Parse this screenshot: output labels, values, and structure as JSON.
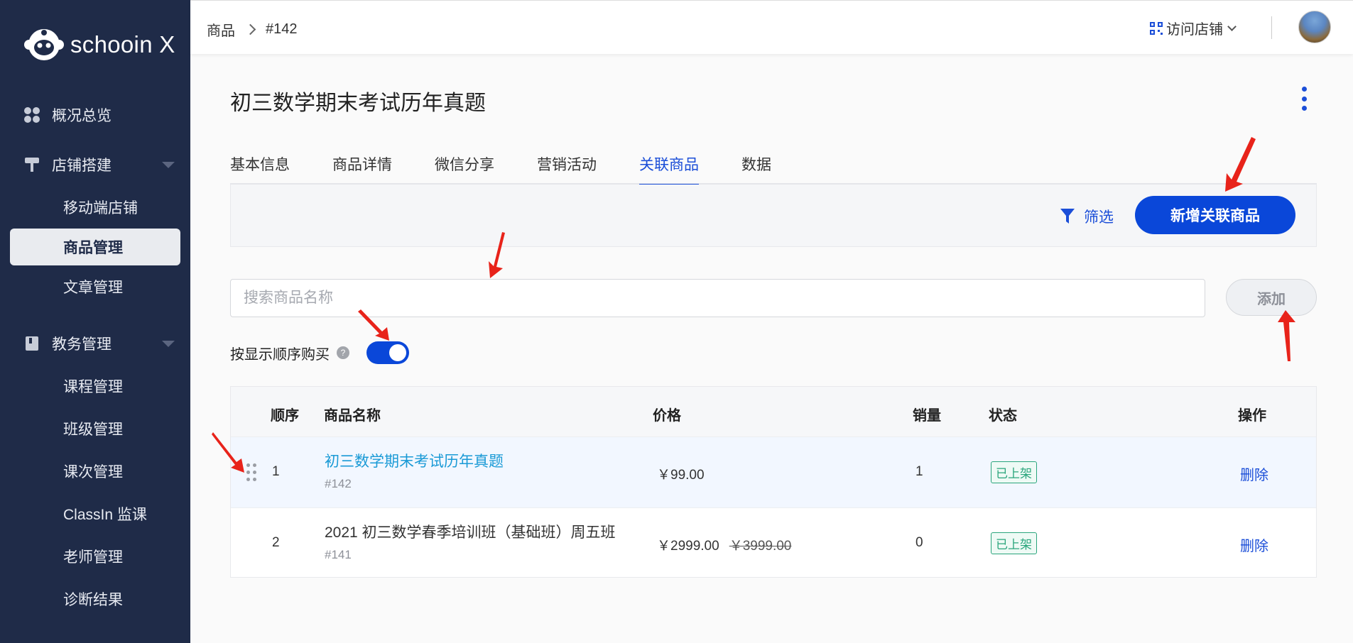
{
  "app": {
    "logo_text": "schooin X"
  },
  "sidebar": {
    "groups": [
      {
        "label": "概况总览"
      },
      {
        "label": "店铺搭建",
        "children": [
          "移动端店铺",
          "商品管理",
          "文章管理"
        ]
      },
      {
        "label": "教务管理",
        "children": [
          "课程管理",
          "班级管理",
          "课次管理",
          "ClassIn 监课",
          "老师管理",
          "诊断结果"
        ]
      }
    ],
    "active_item": "商品管理"
  },
  "topbar": {
    "breadcrumb": [
      "商品",
      "#142"
    ],
    "visit_store": "访问店铺"
  },
  "page": {
    "title": "初三数学期末考试历年真题",
    "tabs": [
      "基本信息",
      "商品详情",
      "微信分享",
      "营销活动",
      "关联商品",
      "数据"
    ],
    "active_tab": "关联商品"
  },
  "toolbar": {
    "filter_label": "筛选",
    "add_related_label": "新增关联商品"
  },
  "search": {
    "placeholder": "搜索商品名称",
    "value": ""
  },
  "add_button": "添加",
  "order_option": {
    "label": "按显示顺序购买",
    "help": "?",
    "enabled": true
  },
  "table": {
    "headers": [
      "顺序",
      "商品名称",
      "价格",
      "销量",
      "状态",
      "操作"
    ],
    "rows": [
      {
        "order": "1",
        "name": "初三数学期末考试历年真题",
        "id": "#142",
        "price": "￥99.00",
        "original_price": "",
        "sales": "1",
        "status": "已上架",
        "action": "删除"
      },
      {
        "order": "2",
        "name": "2021 初三数学春季培训班（基础班）周五班",
        "id": "#141",
        "price": "￥2999.00",
        "original_price": "￥3999.00",
        "sales": "0",
        "status": "已上架",
        "action": "删除"
      }
    ]
  },
  "colors": {
    "sidebar_bg": "#1f2b48",
    "primary": "#0a47d9",
    "link": "#1a9ad6",
    "status_green": "#2aa57c",
    "annotation": "#e8231a"
  }
}
